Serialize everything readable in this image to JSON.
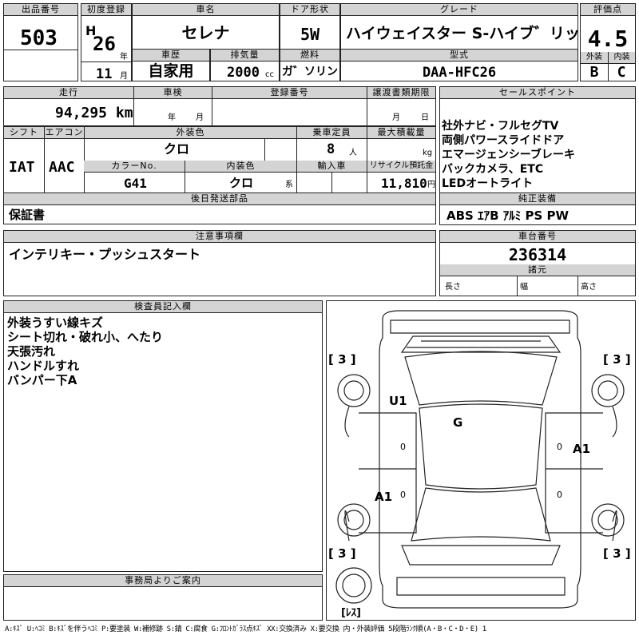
{
  "labels": {
    "lot_no": "出品番号",
    "first_reg": "初度登録",
    "car_name": "車名",
    "door": "ドア形状",
    "grade": "グレード",
    "score": "評価点",
    "history": "車歴",
    "displacement": "排気量",
    "fuel": "燃料",
    "model": "型式",
    "exterior": "外装",
    "interior": "内装",
    "mileage": "走行",
    "inspection": "車検",
    "reg_no": "登録番号",
    "transfer_deadline": "譲渡書類期限",
    "sales_points": "セールスポイント",
    "shift": "シフト",
    "aircon": "エアコン",
    "ext_color": "外装色",
    "capacity": "乗車定員",
    "max_load": "最大積載量",
    "color_no": "カラーNo.",
    "int_color": "内装色",
    "import": "輸入車",
    "recycle": "リサイクル預託金",
    "later_parts": "後日発送部品",
    "genuine": "純正装備",
    "notes": "注意事項欄",
    "chassis_no": "車台番号",
    "specs": "諸元",
    "length": "長さ",
    "width": "幅",
    "height": "高さ",
    "inspector": "検査員記入欄",
    "office": "事務局よりご案内",
    "year_unit": "年",
    "month_unit": "月",
    "cc_unit": "cc",
    "persons_unit": "人",
    "kg_unit": "kg",
    "yen_unit": "円",
    "kei": "系",
    "nen": "年",
    "tsuki": "月"
  },
  "vehicle": {
    "lot_no": "503",
    "era": "H",
    "year": "26",
    "month": "11",
    "name": "セレナ",
    "door": "5W",
    "grade": "ハイウェイスター S-ハイブ゛リッド",
    "score": "4.5",
    "history": "自家用",
    "displacement": "2000",
    "fuel": "ガ゛ソリン",
    "model": "DAA-HFC26",
    "exterior_grade": "B",
    "interior_grade": "C",
    "mileage": "94,295 km",
    "shift": "IAT",
    "aircon": "AAC",
    "ext_color": "クロ",
    "capacity": "8",
    "color_no": "G41",
    "int_color": "クロ",
    "recycle": "11,810",
    "later_parts": "保証書",
    "genuine": "ABS ｴｱB ｱﾙﾐ PS PW",
    "notes": "インテリキー・プッシュスタート",
    "chassis_no": "236314"
  },
  "sales_points": [
    "社外ナビ・フルセグTV",
    "両側パワースライドドア",
    "エマージェンシーブレーキ",
    "バックカメラ、ETC",
    "LEDオートライト"
  ],
  "inspector_notes": [
    "外装うすい線キズ",
    "シート切れ・破れ小、へたり",
    "天張汚れ",
    "ハンドルすれ",
    "バンパー下A"
  ],
  "diagram": {
    "tire_left_top": "[ 3 ]",
    "tire_right_top": "[ 3 ]",
    "tire_left_bottom": "[ 3 ]",
    "tire_right_bottom": "[ 3 ]",
    "spare": "[ﾚｽ]",
    "mark_u1": "U1",
    "mark_g": "G",
    "mark_a1_right": "A1",
    "mark_a1_left": "A1",
    "zero_left": "0",
    "zero_right": "0",
    "zero_left2": "0",
    "zero_right2": "0"
  },
  "legend": "A:ｷｽﾞ U:ﾍｺﾐ B:ｷｽﾞを伴うﾍｺﾐ P:要塗装 W:補修跡 S:錆 C:腐食 G:ﾌﾛﾝﾄｶﾞﾗｽ点ｷｽﾞ XX:交換済み X:要交換 内・外装評価 5段階ﾗﾝｸ順(A・B・C・D・E) 1"
}
